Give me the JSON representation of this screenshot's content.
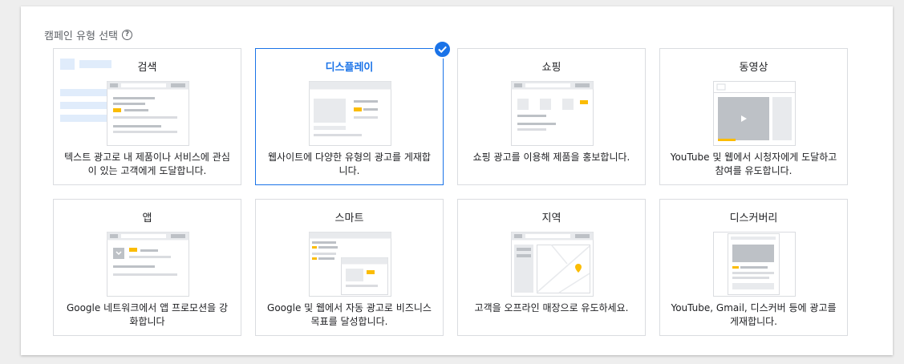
{
  "heading": {
    "title": "캠페인 유형 선택",
    "help_icon": "?"
  },
  "colors": {
    "accent": "#1a73e8",
    "yellow": "#fbbc04",
    "border": "#dadce0"
  },
  "cards": [
    {
      "id": "search",
      "title": "검색",
      "desc": "텍스트 광고로 내 제품이나 서비스에 관심이 있는 고객에게 도달합니다.",
      "selected": false,
      "icon": "search-illustration"
    },
    {
      "id": "display",
      "title": "디스플레이",
      "desc": "웹사이트에 다양한 유형의 광고를 게재합니다.",
      "selected": true,
      "icon": "display-illustration"
    },
    {
      "id": "shopping",
      "title": "쇼핑",
      "desc": "쇼핑 광고를 이용해 제품을 홍보합니다.",
      "selected": false,
      "icon": "shopping-illustration"
    },
    {
      "id": "video",
      "title": "동영상",
      "desc": "YouTube 및 웹에서 시청자에게 도달하고 참여를 유도합니다.",
      "selected": false,
      "icon": "video-illustration"
    },
    {
      "id": "app",
      "title": "앱",
      "desc": "Google 네트워크에서 앱 프로모션을 강화합니다",
      "selected": false,
      "icon": "app-illustration"
    },
    {
      "id": "smart",
      "title": "스마트",
      "desc": "Google 및 웹에서 자동 광고로 비즈니스 목표를 달성합니다.",
      "selected": false,
      "icon": "smart-illustration"
    },
    {
      "id": "local",
      "title": "지역",
      "desc": "고객을 오프라인 매장으로 유도하세요.",
      "selected": false,
      "icon": "local-illustration"
    },
    {
      "id": "discovery",
      "title": "디스커버리",
      "desc": "YouTube, Gmail, 디스커버 등에 광고를 게재합니다.",
      "selected": false,
      "icon": "discovery-illustration"
    }
  ]
}
